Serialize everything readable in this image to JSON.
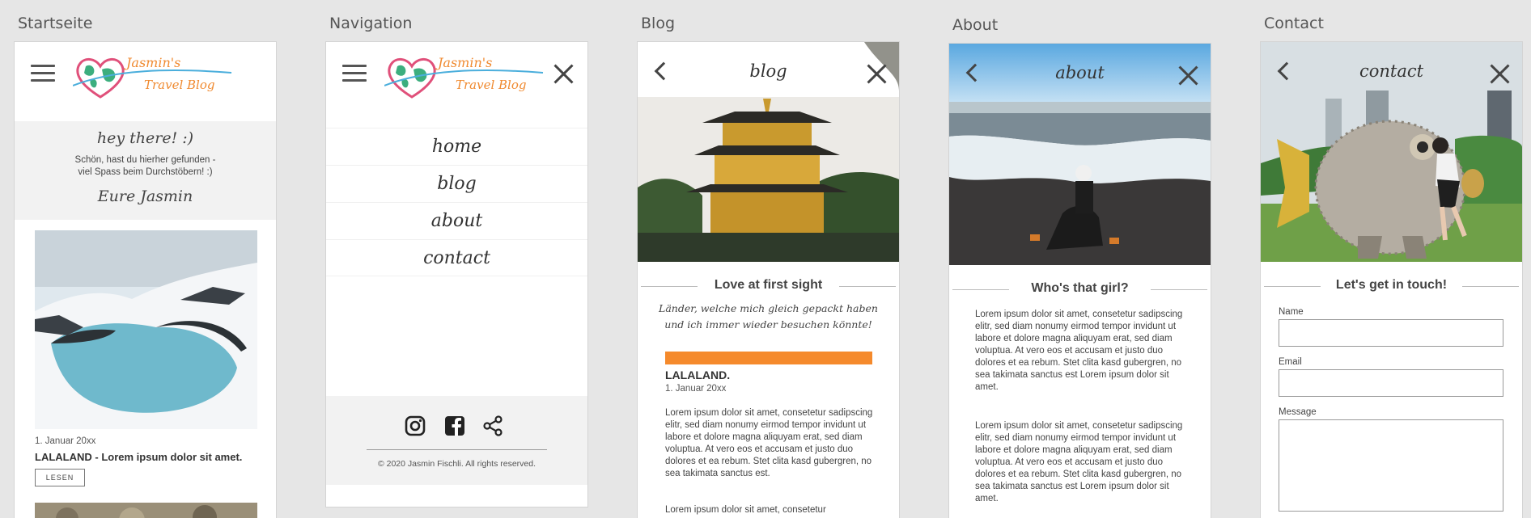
{
  "artboards": [
    "Startseite",
    "Navigation",
    "Blog",
    "About",
    "Contact"
  ],
  "logo": {
    "line1": "Jasmin's",
    "line2": "Travel Blog"
  },
  "home": {
    "greeting": "hey there! :)",
    "welcome_line1": "Schön, hast du hierher gefunden -",
    "welcome_line2": "viel Spass beim Durchstöbern! :)",
    "signature": "Eure Jasmin",
    "post_date": "1. Januar 20xx",
    "post_title": "LALALAND - Lorem ipsum dolor sit amet.",
    "read_button": "LESEN"
  },
  "nav": {
    "items": [
      "home",
      "blog",
      "about",
      "contact"
    ],
    "footer": "© 2020 Jasmin Fischli. All rights reserved."
  },
  "blog": {
    "title": "blog",
    "section": "Love at first sight",
    "quote_line1": "Länder, welche mich gleich gepackt haben",
    "quote_line2": "und ich immer wieder besuchen könnte!",
    "post_title": "LALALAND.",
    "post_date": "1. Januar 20xx",
    "body": "Lorem ipsum dolor sit amet, consetetur sadipscing elitr, sed diam nonumy eirmod tempor invidunt ut labore et dolore magna aliquyam erat, sed diam voluptua. At vero eos et accusam et justo duo dolores et ea rebum. Stet clita kasd gubergren, no sea takimata sanctus est.",
    "body2": "Lorem ipsum dolor sit amet, consetetur"
  },
  "about": {
    "title": "about",
    "section": "Who's that girl?",
    "para1": "Lorem ipsum dolor sit amet, consetetur sadipscing elitr, sed diam nonumy eirmod tempor invidunt ut labore et dolore magna aliquyam erat, sed diam voluptua. At vero eos et accusam et justo duo dolores et ea rebum. Stet clita kasd gubergren, no sea takimata sanctus est Lorem ipsum dolor sit amet.",
    "para2": "Lorem ipsum dolor sit amet, consetetur sadipscing elitr, sed diam nonumy eirmod tempor invidunt ut labore et dolore magna aliquyam erat, sed diam voluptua. At vero eos et accusam et justo duo dolores et ea rebum. Stet clita kasd gubergren, no sea takimata sanctus est Lorem ipsum dolor sit amet."
  },
  "contact": {
    "title": "contact",
    "section": "Let's get in touch!",
    "name_label": "Name",
    "email_label": "Email",
    "message_label": "Message"
  },
  "colors": {
    "accent": "#f08a30",
    "background": "#e6e6e6"
  }
}
